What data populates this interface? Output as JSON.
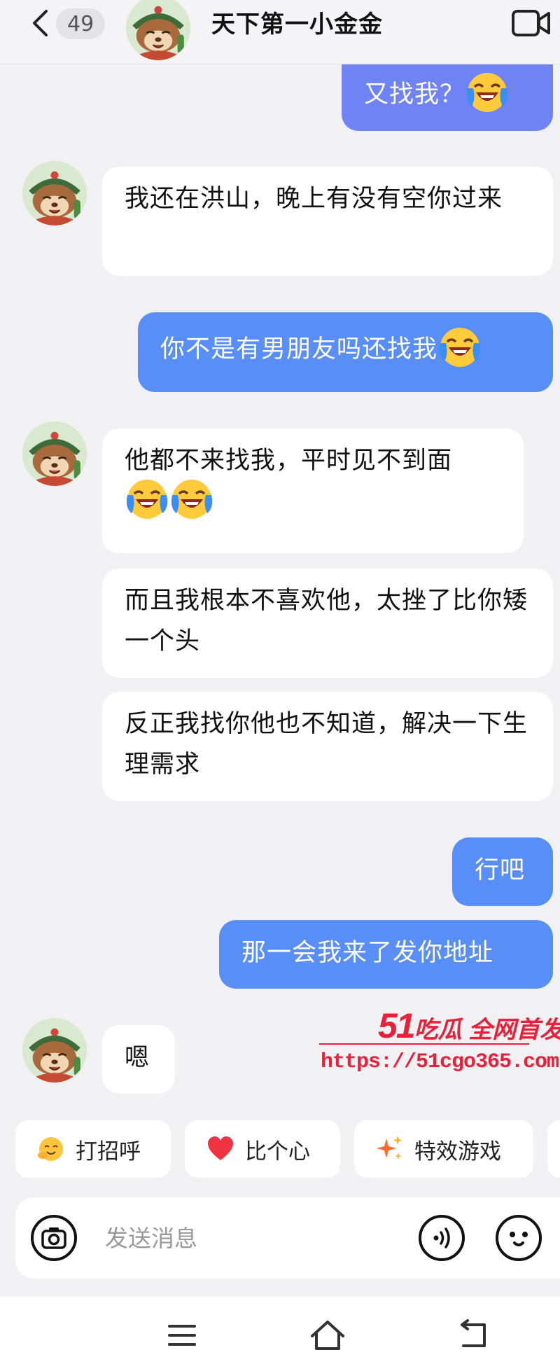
{
  "header": {
    "unread_count": "49",
    "contact_name": "天下第一小金金"
  },
  "messages": [
    {
      "side": "out",
      "text": "又找我？",
      "emoji": "crying-laughing"
    },
    {
      "side": "in",
      "text": "我还在洪山，晚上有没有空你过来"
    },
    {
      "side": "out",
      "text": "你不是有男朋友吗还找我",
      "emoji": "crying-laughing"
    },
    {
      "side": "in",
      "text": "他都不来找我，平时见不到面",
      "emoji_count": 2
    },
    {
      "side": "in",
      "text": "而且我根本不喜欢他，太挫了比你矮一个头"
    },
    {
      "side": "in",
      "text": "反正我找你他也不知道，解决一下生理需求"
    },
    {
      "side": "out",
      "text": "行吧"
    },
    {
      "side": "out",
      "text": "那一会我来了发你地址"
    },
    {
      "side": "in",
      "text": "嗯"
    }
  ],
  "watermark": {
    "number": "51",
    "brand": "吃瓜 全网首发",
    "url": "https://51cgo365.com"
  },
  "quick_actions": [
    {
      "label": "打招呼",
      "icon": "waving-face-icon"
    },
    {
      "label": "比个心",
      "icon": "heart-icon"
    },
    {
      "label": "特效游戏",
      "icon": "sparkles-icon"
    }
  ],
  "composer": {
    "placeholder": "发送消息"
  },
  "colors": {
    "outgoing_bubble": "#5a8ef7",
    "incoming_bubble": "#ffffff",
    "background": "#f1f1f4",
    "watermark": "#e8203a"
  }
}
